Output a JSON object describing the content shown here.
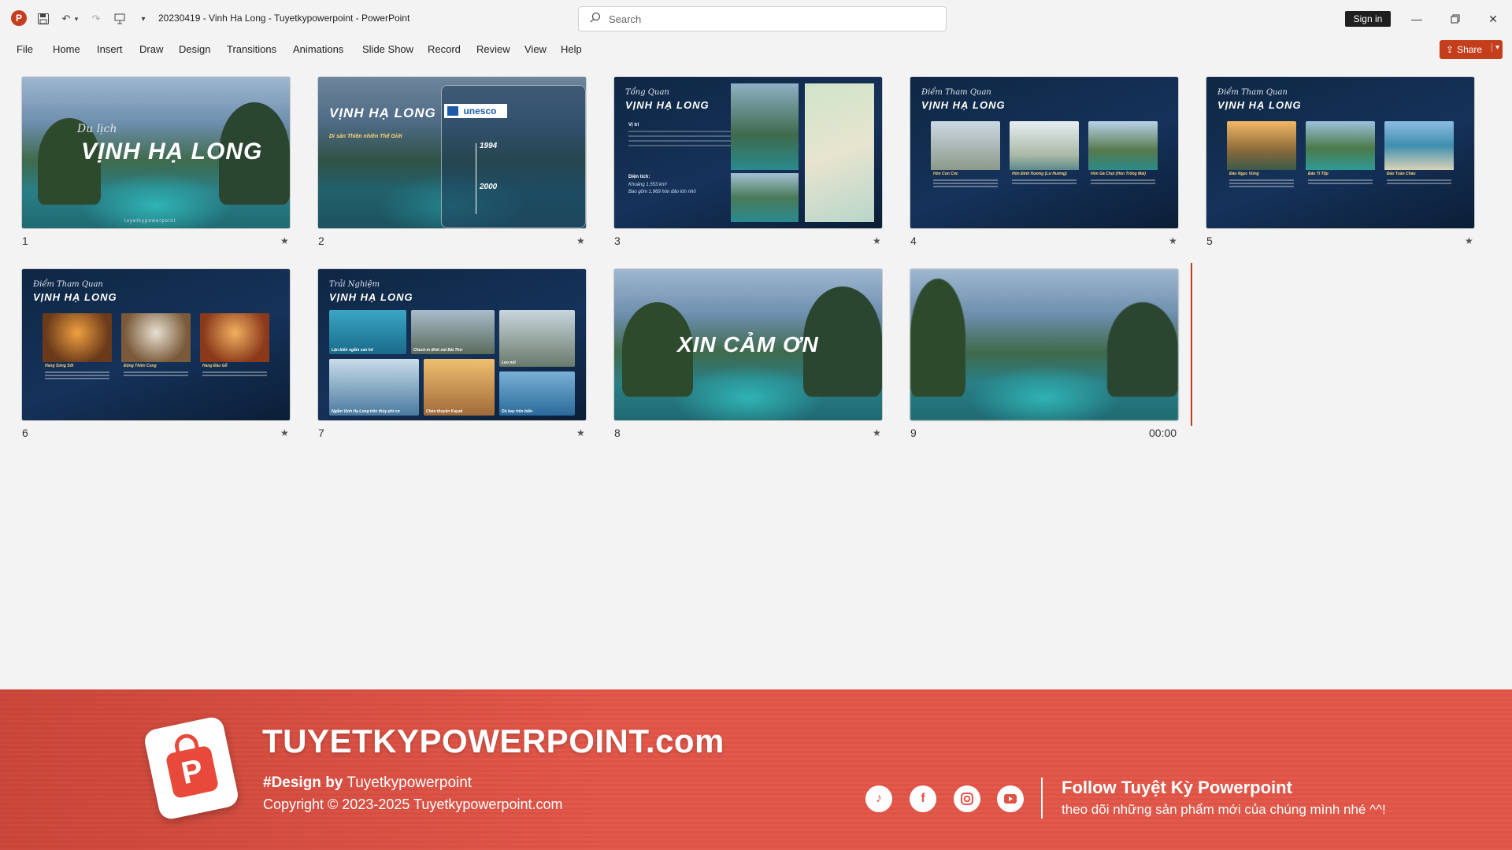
{
  "titlebar": {
    "doc_title": "20230419 - Vinh Ha Long - Tuyetkypowerpoint  -  PowerPoint",
    "search_placeholder": "Search",
    "sign_in": "Sign in"
  },
  "menu": [
    "File",
    "Home",
    "Insert",
    "Draw",
    "Design",
    "Transitions",
    "Animations",
    "Slide Show",
    "Record",
    "Review",
    "View",
    "Help"
  ],
  "share_label": "Share",
  "slides": [
    {
      "number": "1",
      "title": "VỊNH HẠ LONG",
      "script": "Du lịch",
      "footer": "tuyetkypowerpoint"
    },
    {
      "number": "2",
      "title": "VỊNH HẠ LONG",
      "subtitle": "Di sản Thiên nhiên Thế Giới",
      "badge": "unesco",
      "year1": "1994",
      "year2": "2000"
    },
    {
      "number": "3",
      "script": "Tổng Quan",
      "title": "VỊNH HẠ LONG",
      "label1": "Vị trí",
      "label2": "Diện tích:",
      "area": "Khoảng 1.553 km²",
      "islands": "Bao gồm 1.969 hòn đảo lớn nhỏ"
    },
    {
      "number": "4",
      "script": "Điểm Tham Quan",
      "title": "VỊNH HẠ LONG",
      "cards": [
        "Hòn Con Cóc",
        "Hòn Đỉnh Hương (Lư Hương)",
        "Hòn Gà Chọi (Hòn Trống Mái)"
      ]
    },
    {
      "number": "5",
      "script": "Điểm Tham Quan",
      "title": "VỊNH HẠ LONG",
      "cards": [
        "Đảo Ngọc Vừng",
        "Đảo Ti Tốp",
        "Đảo Tuần Châu"
      ]
    },
    {
      "number": "6",
      "script": "Điểm Tham Quan",
      "title": "VỊNH HẠ LONG",
      "cards": [
        "Hang Sửng Sốt",
        "Động Thiên Cung",
        "Hang Đầu Gỗ"
      ]
    },
    {
      "number": "7",
      "script": "Trải Nghiệm",
      "title": "VỊNH HẠ LONG",
      "cards": [
        "Lặn biển ngắm san hô",
        "Check-in đỉnh núi Bài Thơ",
        "Leo núi",
        "Ngắm Vịnh Hạ Long trên thủy phi cơ",
        "Chèo thuyền Kayak",
        "Dù bay trên biển"
      ]
    },
    {
      "number": "8",
      "title": "XIN CẢM ƠN"
    },
    {
      "number": "9",
      "time": "00:00"
    }
  ],
  "banner": {
    "site": "TUYETKYPOWERPOINT.com",
    "design_prefix": "#Design by",
    "design_name": "Tuyetkypowerpoint",
    "copyright": "Copyright © 2023-2025 Tuyetkypowerpoint.com",
    "social": [
      "tiktok-icon",
      "facebook-icon",
      "instagram-icon",
      "youtube-icon"
    ],
    "follow": "Follow Tuyệt Kỳ Powerpoint",
    "follow_sub": "theo dõi những sản phẩm mới của chúng mình nhé ^^!"
  },
  "colors": {
    "accent": "#c43e1c",
    "banner": "#e25a4c"
  }
}
